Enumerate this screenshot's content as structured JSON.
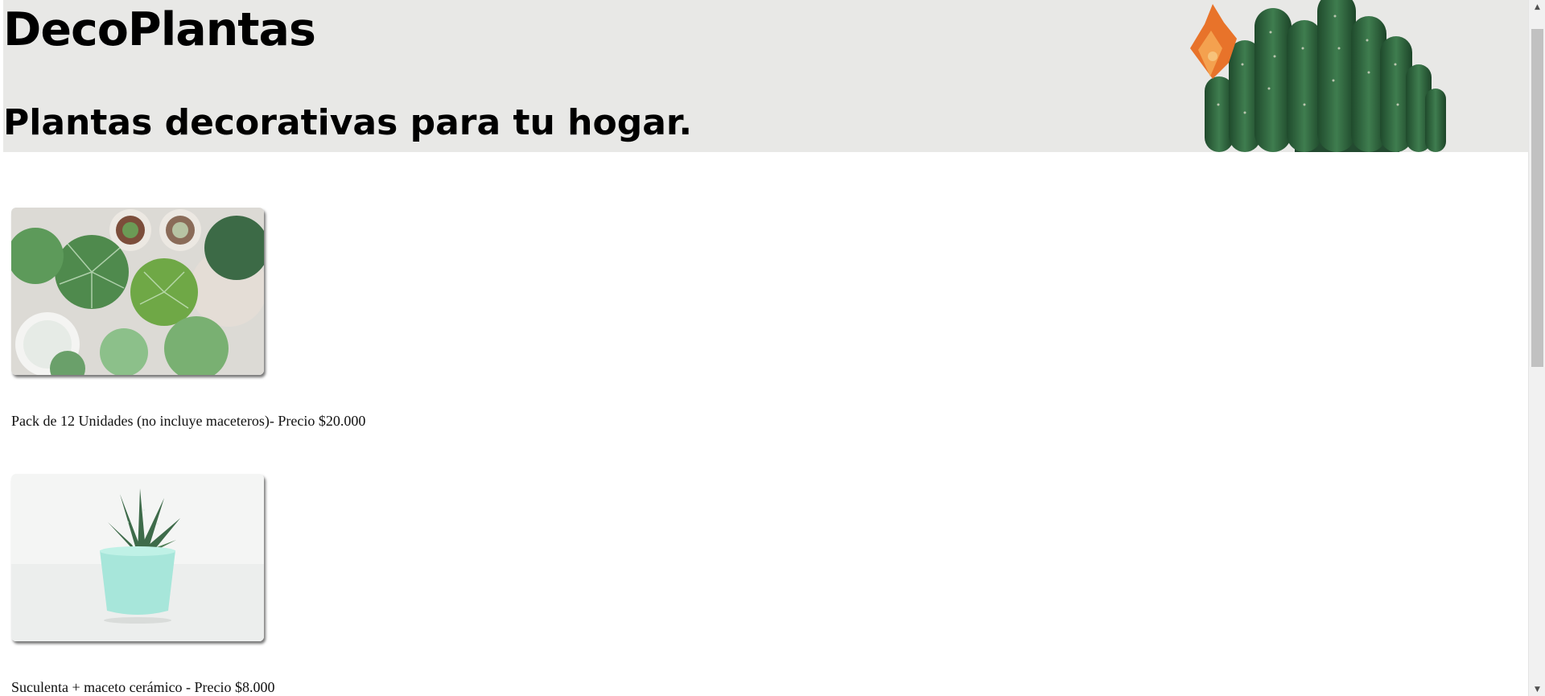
{
  "site": {
    "brand": "DecoPlantas",
    "tagline": "Plantas decorativas para tu hogar."
  },
  "header_art": {
    "icon": "flowering-cactus-image",
    "colors": {
      "banner": "#e8e8e6",
      "cactus": "#2f5e3c",
      "flower": "#e8732a"
    }
  },
  "products": [
    {
      "image_icon": "succulent-collection-photo",
      "caption": "Pack de 12 Unidades (no incluye maceteros)- Precio $20.000"
    },
    {
      "image_icon": "succulent-in-mint-pot-photo",
      "caption": "Suculenta + maceto cerámico - Precio $8.000"
    }
  ],
  "scrollbar": {
    "up_icon": "scroll-up-arrow-icon",
    "down_icon": "scroll-down-arrow-icon",
    "up_glyph": "▲",
    "down_glyph": "▼"
  }
}
